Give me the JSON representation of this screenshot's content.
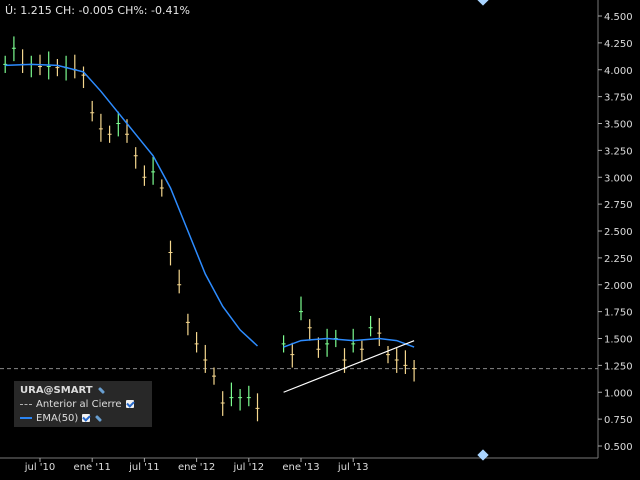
{
  "info": {
    "last_label": "Ú:",
    "last_value": "1.215",
    "change_label": "CH:",
    "change_value": "-0.005",
    "change_pct_label": "CH%:",
    "change_pct_value": "-0.41%"
  },
  "legend": {
    "symbol": "URA@SMART",
    "prev_close_label": "Anterior al Cierre",
    "ema_label": "EMA(50)"
  },
  "colors": {
    "background": "#000000",
    "up_bar": "#7CFC90",
    "down_bar": "#F5D78E",
    "ema_line": "#2D8CFF",
    "trendline": "#FFFFFF",
    "prev_close_line": "#888888",
    "grid": "#3a3a3a",
    "axis_text": "#dddddd"
  },
  "chart_data": {
    "type": "ohlc",
    "symbol": "URA@SMART",
    "xlabels": [
      "jul '10",
      "ene '11",
      "jul '11",
      "ene '12",
      "jul '12",
      "ene '13",
      "jul '13"
    ],
    "yticks": [
      "0.500",
      "0.750",
      "1.000",
      "1.250",
      "1.500",
      "1.750",
      "2.000",
      "2.250",
      "2.500",
      "2.750",
      "3.000",
      "3.250",
      "3.500",
      "3.750",
      "4.000",
      "4.250",
      "4.500"
    ],
    "ylim": [
      0.5,
      4.5
    ],
    "prev_close": 1.22,
    "series": [
      {
        "name": "URA@SMART",
        "points": [
          [
            "2010-03",
            4.05
          ],
          [
            "2010-04",
            4.2
          ],
          [
            "2010-05",
            4.05
          ],
          [
            "2010-06",
            4.05
          ],
          [
            "2010-07",
            4.03
          ],
          [
            "2010-08",
            4.03
          ],
          [
            "2010-09",
            4.02
          ],
          [
            "2010-10",
            4.02
          ],
          [
            "2010-11",
            4.0
          ],
          [
            "2010-12",
            3.95
          ],
          [
            "2011-01",
            3.6
          ],
          [
            "2011-02",
            3.45
          ],
          [
            "2011-03",
            3.4
          ],
          [
            "2011-04",
            3.5
          ],
          [
            "2011-05",
            3.4
          ],
          [
            "2011-06",
            3.2
          ],
          [
            "2011-07",
            3.0
          ],
          [
            "2011-08",
            3.05
          ],
          [
            "2011-09",
            2.9
          ],
          [
            "2011-10",
            2.3
          ],
          [
            "2011-11",
            2.0
          ],
          [
            "2011-12",
            1.65
          ],
          [
            "2012-01",
            1.45
          ],
          [
            "2012-02",
            1.3
          ],
          [
            "2012-03",
            1.15
          ],
          [
            "2012-04",
            0.9
          ],
          [
            "2012-05",
            0.95
          ],
          [
            "2012-06",
            0.95
          ],
          [
            "2012-07",
            0.95
          ],
          [
            "2012-08",
            0.85
          ],
          [
            "2012-11",
            1.45
          ],
          [
            "2012-12",
            1.35
          ],
          [
            "2013-01",
            1.75
          ],
          [
            "2013-02",
            1.6
          ],
          [
            "2013-03",
            1.4
          ],
          [
            "2013-04",
            1.45
          ],
          [
            "2013-05",
            1.5
          ],
          [
            "2013-06",
            1.3
          ],
          [
            "2013-07",
            1.45
          ],
          [
            "2013-08",
            1.4
          ],
          [
            "2013-09",
            1.6
          ],
          [
            "2013-10",
            1.55
          ],
          [
            "2013-11",
            1.35
          ],
          [
            "2013-12",
            1.3
          ],
          [
            "2014-01",
            1.25
          ],
          [
            "2014-02",
            1.22
          ]
        ]
      },
      {
        "name": "EMA(50)",
        "points": [
          [
            "2010-03",
            4.04
          ],
          [
            "2010-06",
            4.05
          ],
          [
            "2010-09",
            4.04
          ],
          [
            "2010-12",
            3.98
          ],
          [
            "2011-02",
            3.8
          ],
          [
            "2011-04",
            3.6
          ],
          [
            "2011-06",
            3.4
          ],
          [
            "2011-08",
            3.2
          ],
          [
            "2011-10",
            2.9
          ],
          [
            "2011-12",
            2.5
          ],
          [
            "2012-02",
            2.1
          ],
          [
            "2012-04",
            1.8
          ],
          [
            "2012-06",
            1.58
          ],
          [
            "2012-08",
            1.43
          ],
          [
            "2012-11",
            1.42
          ],
          [
            "2013-01",
            1.48
          ],
          [
            "2013-04",
            1.5
          ],
          [
            "2013-07",
            1.48
          ],
          [
            "2013-10",
            1.5
          ],
          [
            "2013-12",
            1.48
          ],
          [
            "2014-02",
            1.42
          ]
        ]
      },
      {
        "name": "trendline",
        "points": [
          [
            "2012-11",
            1.0
          ],
          [
            "2014-02",
            1.48
          ]
        ]
      }
    ]
  }
}
